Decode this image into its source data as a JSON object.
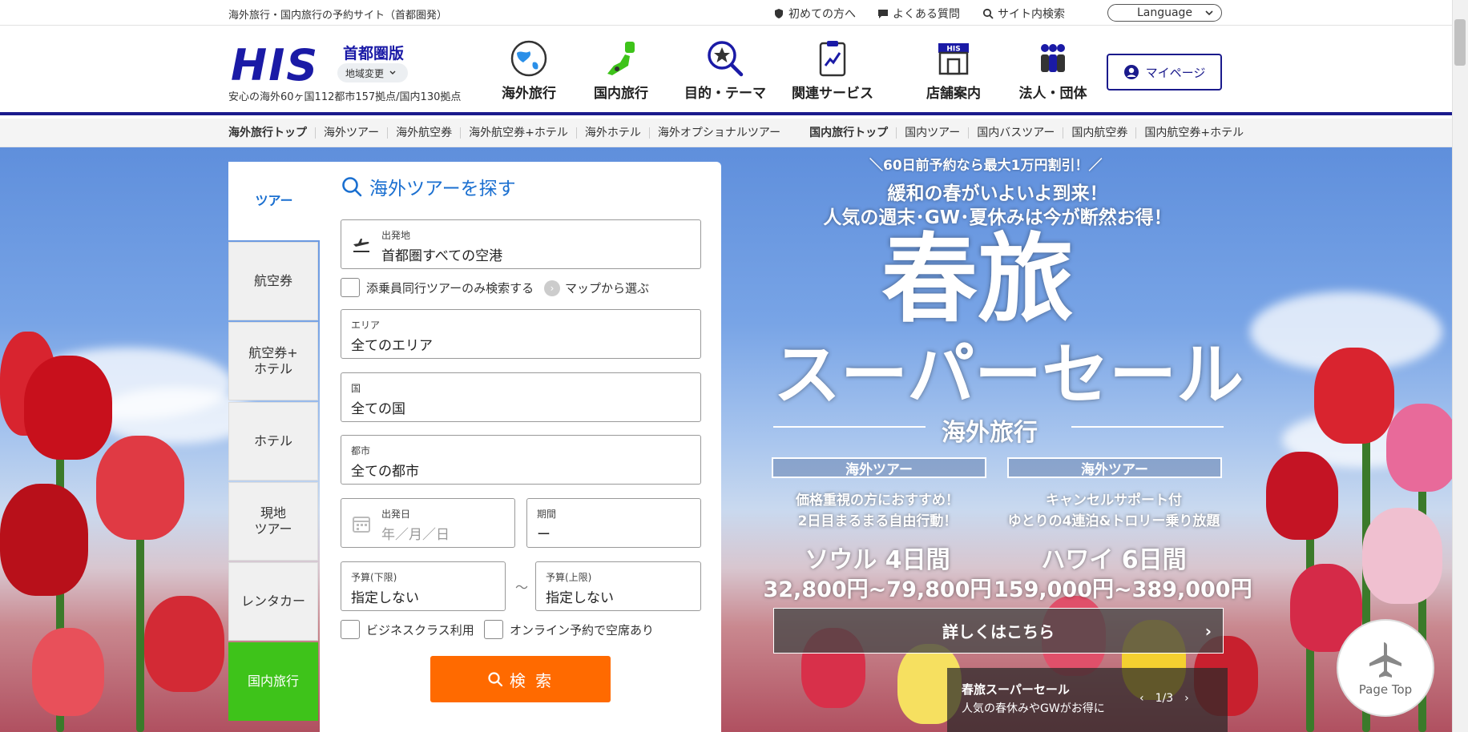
{
  "topbar": {
    "tagline": "海外旅行・国内旅行の予約サイト（首都圏発）",
    "links": [
      {
        "label": "初めての方へ",
        "icon": "shield-icon"
      },
      {
        "label": "よくある質問",
        "icon": "chat-icon"
      },
      {
        "label": "サイト内検索",
        "icon": "search-icon"
      }
    ],
    "language": "Language"
  },
  "header": {
    "logo": "HIS",
    "region": "首都圏版",
    "region_change": "地域変更",
    "sub": "安心の海外60ヶ国112都市157拠点/国内130拠点",
    "nav": [
      {
        "label": "海外旅行",
        "icon": "globe-icon"
      },
      {
        "label": "国内旅行",
        "icon": "japan-map-icon"
      },
      {
        "label": "目的・テーマ",
        "icon": "magnifier-star-icon"
      },
      {
        "label": "関連サービス",
        "icon": "clipboard-icon"
      },
      {
        "label": "店舗案内",
        "icon": "store-icon"
      },
      {
        "label": "法人・団体",
        "icon": "group-icon"
      }
    ],
    "mypage": "マイページ"
  },
  "subnav": {
    "overseas": [
      "海外旅行トップ",
      "海外ツアー",
      "海外航空券",
      "海外航空券+ホテル",
      "海外ホテル",
      "海外オプショナルツアー"
    ],
    "domestic": [
      "国内旅行トップ",
      "国内ツアー",
      "国内バスツアー",
      "国内航空券",
      "国内航空券+ホテル"
    ]
  },
  "search": {
    "tabs": [
      "ツアー",
      "航空券",
      "航空券+\nホテル",
      "ホテル",
      "現地\nツアー",
      "レンタカー",
      "国内旅行"
    ],
    "title": "海外ツアーを探す",
    "departure": {
      "label": "出発地",
      "value": "首都圏すべての空港"
    },
    "escort_only": "添乗員同行ツアーのみ検索する",
    "map_select": "マップから選ぶ",
    "area": {
      "label": "エリア",
      "value": "全てのエリア"
    },
    "country": {
      "label": "国",
      "value": "全ての国"
    },
    "city": {
      "label": "都市",
      "value": "全ての都市"
    },
    "date": {
      "label": "出発日",
      "value": "年／月／日"
    },
    "period": {
      "label": "期間",
      "value": "ー"
    },
    "budget_min": {
      "label": "予算(下限)",
      "value": "指定しない"
    },
    "budget_sep": "～",
    "budget_max": {
      "label": "予算(上限)",
      "value": "指定しない"
    },
    "business_class": "ビジネスクラス利用",
    "online_available": "オンライン予約で空席あり",
    "button": "検 索"
  },
  "promo": {
    "small": "＼60日前予約なら最大1万円割引！／",
    "head1": "緩和の春がいよいよ到来！",
    "head2": "人気の週末･GW･夏休みは今が断然お得！",
    "big": "春旅",
    "sale": "スーパーセール",
    "category": "海外旅行",
    "left": {
      "box": "海外ツアー",
      "desc1": "価格重視の方におすすめ！",
      "desc2": "2日目まるまる自由行動！",
      "dest": "ソウル 4日間",
      "price": "32,800円~79,800円"
    },
    "right": {
      "box": "海外ツアー",
      "desc1": "キャンセルサポート付",
      "desc2": "ゆとりの4連泊&トロリー乗り放題",
      "dest": "ハワイ 6日間",
      "price": "159,000円~389,000円"
    },
    "cta": "詳しくはこちら",
    "caption_title": "春旅スーパーセール",
    "caption_desc": "人気の春休みやGWがお得に",
    "slide": "1/3"
  },
  "pagetop": "Page Top",
  "colors": {
    "brand": "#1a1aa6",
    "accent": "#1a6fd0",
    "search_button": "#ff6a00",
    "domestic_tab": "#3ec31a"
  }
}
